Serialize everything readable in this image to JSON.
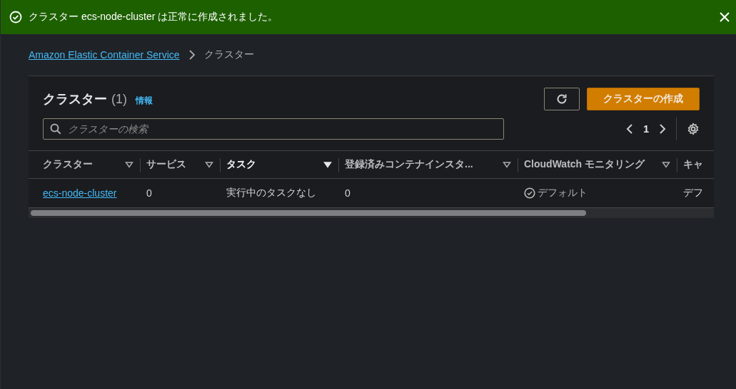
{
  "flash": {
    "message": "クラスター ecs-node-cluster は正常に作成されました。"
  },
  "breadcrumb": {
    "items": [
      "Amazon Elastic Container Service",
      "クラスター"
    ]
  },
  "panel": {
    "title": "クラスター",
    "count": "(1)",
    "info": "情報",
    "create_button": "クラスターの作成",
    "search": {
      "placeholder": "クラスターの検索"
    },
    "page": "1"
  },
  "table": {
    "columns": [
      {
        "label": "クラスター",
        "sorted": false
      },
      {
        "label": "サービス",
        "sorted": false
      },
      {
        "label": "タスク",
        "sorted": true
      },
      {
        "label": "登録済みコンテナインスタ...",
        "sorted": false
      },
      {
        "label": "CloudWatch モニタリング",
        "sorted": false
      },
      {
        "label": "キャ",
        "sorted": false
      }
    ],
    "rows": [
      {
        "cells": [
          {
            "kind": "link",
            "text": "ecs-node-cluster"
          },
          {
            "kind": "text",
            "text": "0"
          },
          {
            "kind": "text",
            "text": "実行中のタスクなし"
          },
          {
            "kind": "text",
            "text": "0"
          },
          {
            "kind": "status",
            "text": "デフォルト"
          },
          {
            "kind": "text",
            "text": "デフ"
          }
        ]
      }
    ]
  }
}
